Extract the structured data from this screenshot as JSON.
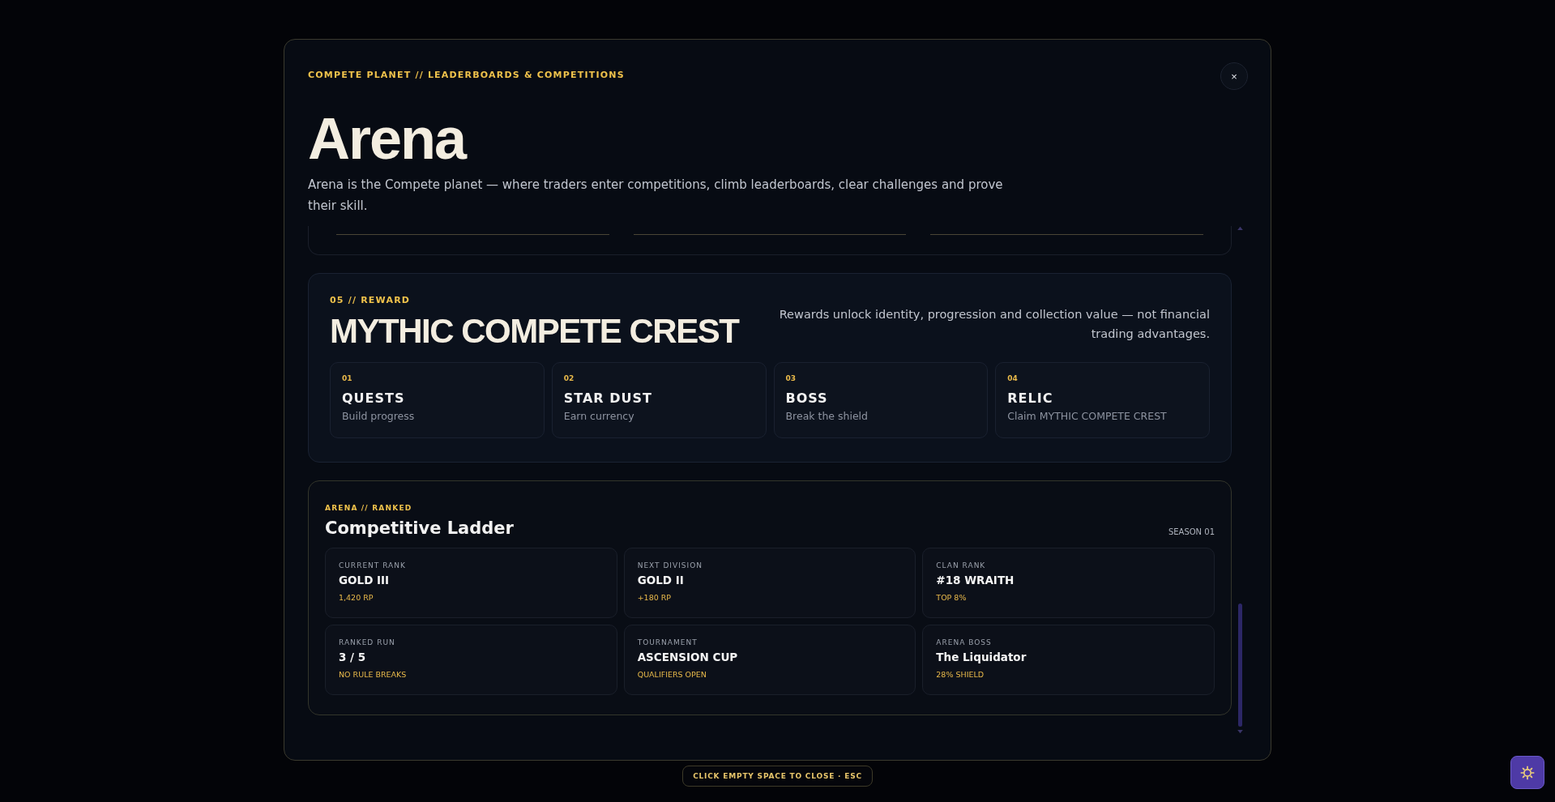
{
  "header": {
    "eyebrow": "COMPETE PLANET // LEADERBOARDS & COMPETITIONS",
    "title": "Arena",
    "description": "Arena is the Compete planet — where traders enter competitions, climb leaderboards, clear challenges and prove their skill."
  },
  "close_button": {
    "label": "×"
  },
  "reward": {
    "eyebrow": "05 // REWARD",
    "title": "MYTHIC COMPETE CREST",
    "note": "Rewards unlock identity, progression and collection value — not financial trading advantages.",
    "steps": [
      {
        "number": "01",
        "title": "QUESTS",
        "subtitle": "Build progress"
      },
      {
        "number": "02",
        "title": "STAR DUST",
        "subtitle": "Earn currency"
      },
      {
        "number": "03",
        "title": "BOSS",
        "subtitle": "Break the shield"
      },
      {
        "number": "04",
        "title": "RELIC",
        "subtitle": "Claim MYTHIC COMPETE CREST"
      }
    ]
  },
  "ladder": {
    "eyebrow": "ARENA // RANKED",
    "title": "Competitive Ladder",
    "season": "SEASON 01",
    "stats": [
      {
        "label": "CURRENT RANK",
        "value": "GOLD III",
        "detail": "1,420 RP"
      },
      {
        "label": "NEXT DIVISION",
        "value": "GOLD II",
        "detail": "+180 RP"
      },
      {
        "label": "CLAN RANK",
        "value": "#18 WRAITH",
        "detail": "TOP 8%"
      },
      {
        "label": "RANKED RUN",
        "value": "3 / 5",
        "detail": "NO RULE BREAKS"
      },
      {
        "label": "TOURNAMENT",
        "value": "ASCENSION CUP",
        "detail": "QUALIFIERS OPEN"
      },
      {
        "label": "ARENA BOSS",
        "value": "The Liquidator",
        "detail": "28% SHIELD"
      }
    ]
  },
  "hint": "CLICK EMPTY SPACE TO CLOSE · ESC"
}
